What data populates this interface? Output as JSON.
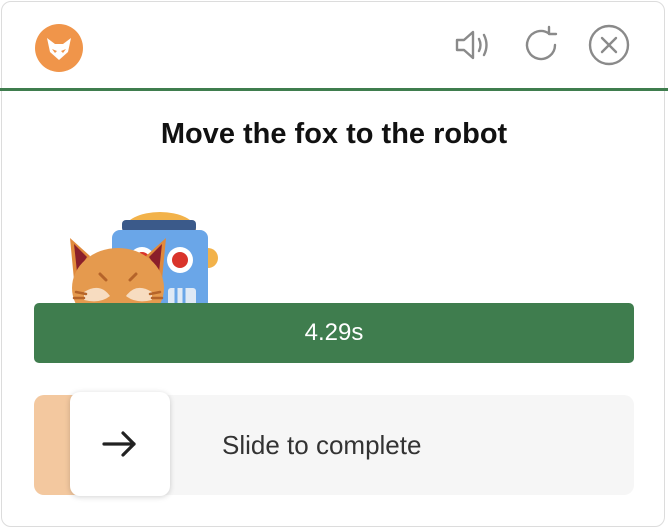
{
  "header": {
    "logo_icon": "fox-logo-icon",
    "sound_icon": "speaker-icon",
    "refresh_icon": "refresh-icon",
    "close_icon": "close-icon"
  },
  "colors": {
    "accent": "#3f7d4e",
    "brand": "#f0954a",
    "slider_progress": "#f3c89f"
  },
  "challenge": {
    "title": "Move the fox to the robot"
  },
  "timer": {
    "label": "4.29s"
  },
  "slider": {
    "label": "Slide to complete",
    "handle_icon": "arrow-right-icon"
  }
}
